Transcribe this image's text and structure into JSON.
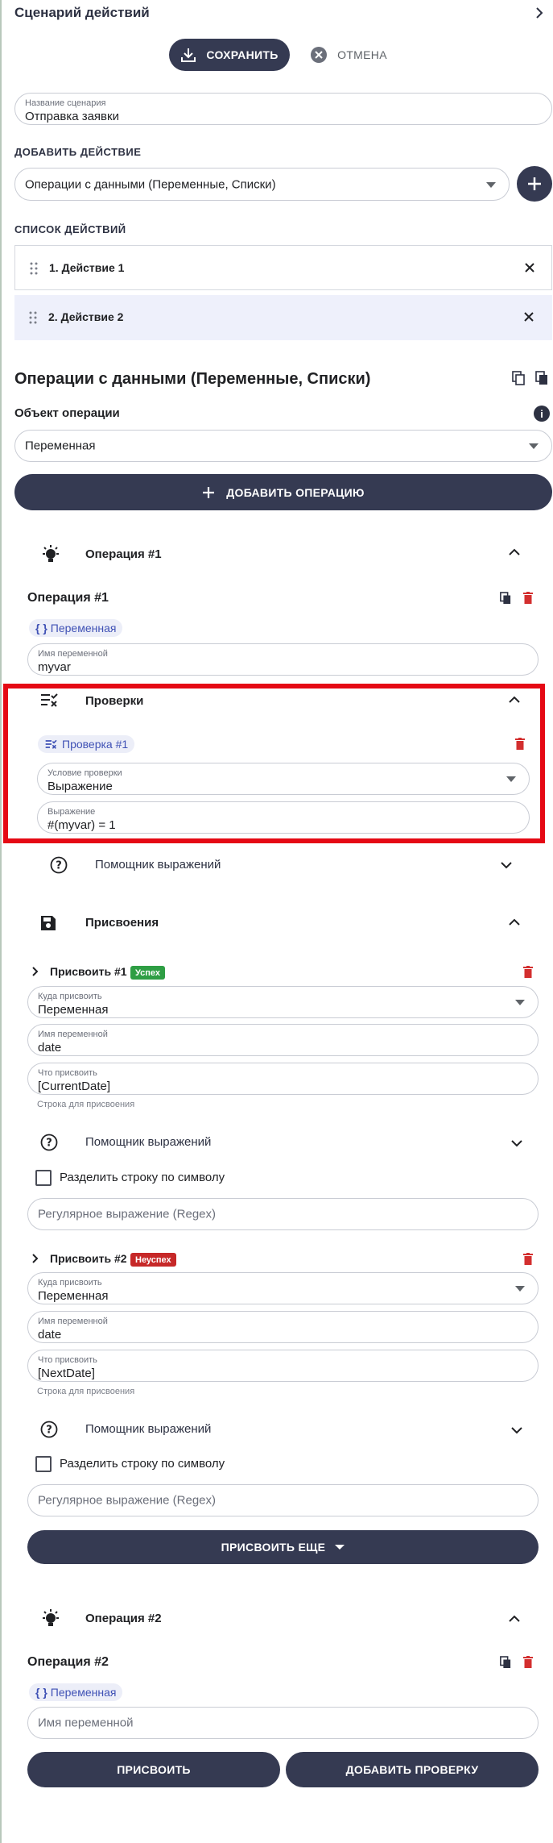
{
  "header": {
    "title": "Сценарий действий"
  },
  "toolbar": {
    "save_label": "СОХРАНИТЬ",
    "cancel_label": "ОТМЕНА"
  },
  "scenario": {
    "name_label": "Название сценария",
    "name_value": "Отправка заявки"
  },
  "add_action": {
    "section_label": "ДОБАВИТЬ ДЕЙСТВИЕ",
    "selected": "Операции с данными (Переменные, Списки)"
  },
  "actions_list": {
    "section_label": "СПИСОК ДЕЙСТВИЙ",
    "items": [
      {
        "label": "1. Действие 1"
      },
      {
        "label": "2. Действие 2"
      }
    ]
  },
  "editor": {
    "title": "Операции с данными (Переменные, Списки)",
    "object_label": "Объект операции",
    "object_value": "Переменная",
    "add_operation_label": "ДОБАВИТЬ ОПЕРАЦИЮ"
  },
  "operation1": {
    "accordion_title": "Операция #1",
    "title": "Операция #1",
    "chip": "Переменная",
    "var_label": "Имя переменной",
    "var_value": "myvar",
    "checks": {
      "title": "Проверки",
      "chip": "Проверка #1",
      "cond_label": "Условие проверки",
      "cond_value": "Выражение",
      "expr_label": "Выражение",
      "expr_value": "#(myvar) = 1"
    },
    "helper_label": "Помощник выражений",
    "assignments": {
      "title": "Присвоения",
      "items": [
        {
          "title": "Присвоить #1",
          "badge": "Успех",
          "target_label": "Куда присвоить",
          "target_value": "Переменная",
          "var_label": "Имя переменной",
          "var_value": "date",
          "what_label": "Что присвоить",
          "what_value": "[CurrentDate]",
          "hint": "Строка для присвоения",
          "helper_label": "Помощник выражений",
          "split_label": "Разделить строку по символу",
          "regex_placeholder": "Регулярное выражение (Regex)"
        },
        {
          "title": "Присвоить #2",
          "badge": "Неуспех",
          "target_label": "Куда присвоить",
          "target_value": "Переменная",
          "var_label": "Имя переменной",
          "var_value": "date",
          "what_label": "Что присвоить",
          "what_value": "[NextDate]",
          "hint": "Строка для присвоения",
          "helper_label": "Помощник выражений",
          "split_label": "Разделить строку по символу",
          "regex_placeholder": "Регулярное выражение (Regex)"
        }
      ],
      "more_label": "ПРИСВОИТЬ ЕЩЕ"
    }
  },
  "operation2": {
    "accordion_title": "Операция #2",
    "title": "Операция #2",
    "chip": "Переменная",
    "var_placeholder": "Имя переменной",
    "assign_label": "ПРИСВОИТЬ",
    "add_check_label": "ДОБАВИТЬ ПРОВЕРКУ"
  },
  "colors": {
    "accent_dark": "#353a52",
    "highlight_frame": "#e50914",
    "success": "#2e9e44",
    "failure": "#c62828",
    "selected_row": "#eef0fb"
  }
}
